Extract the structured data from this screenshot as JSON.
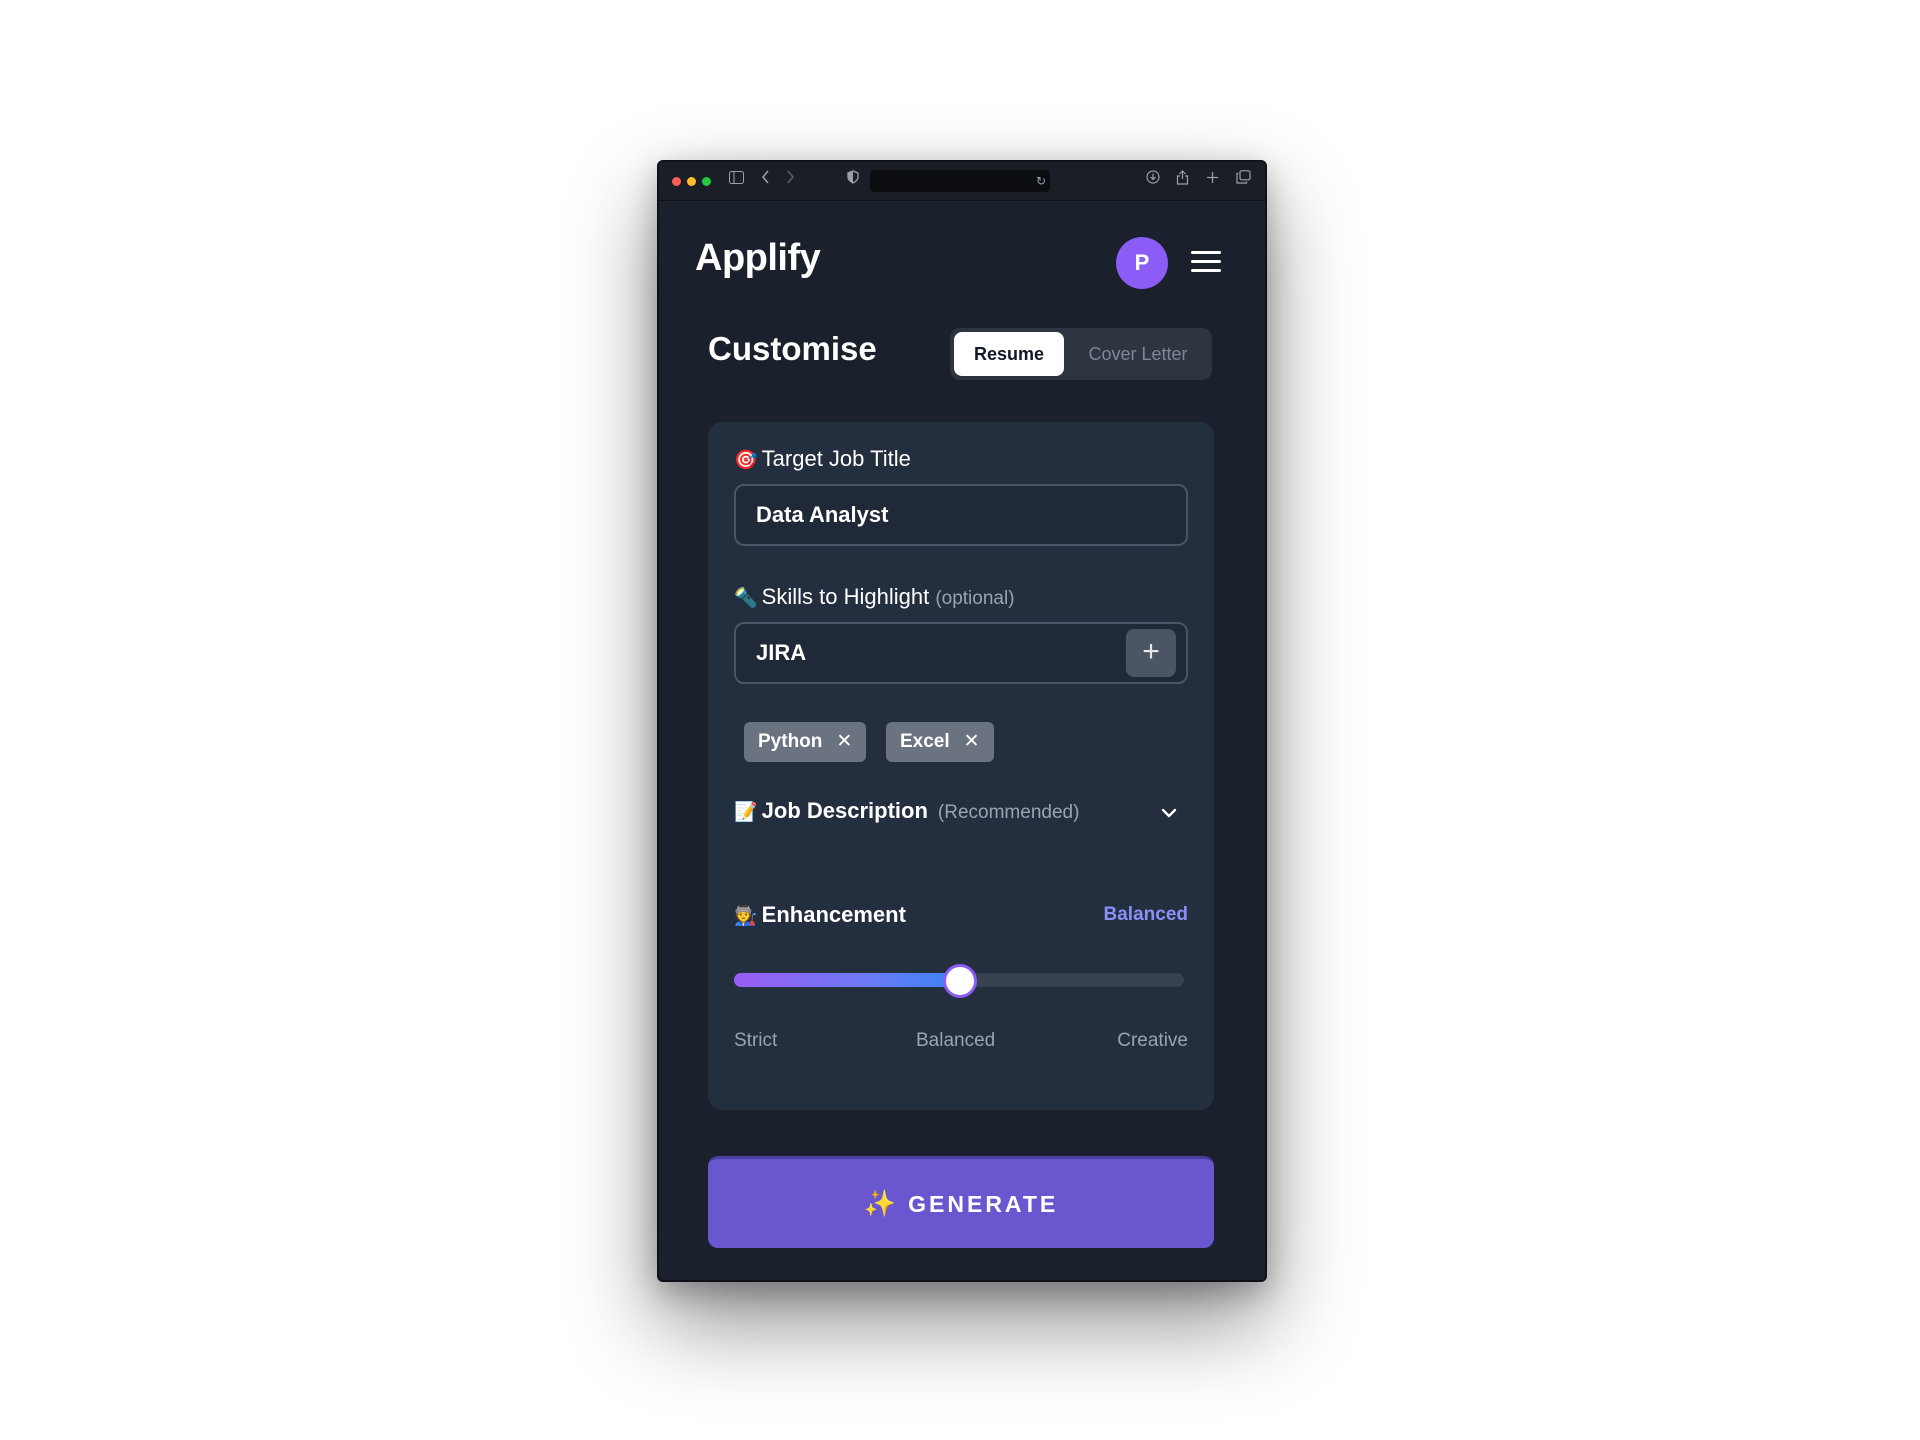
{
  "browser": {
    "icons": [
      "sidebar-icon",
      "back-icon",
      "forward-icon",
      "shield-icon",
      "reload-icon",
      "download-icon",
      "share-icon",
      "new-tab-icon",
      "tabs-icon"
    ]
  },
  "header": {
    "logo": "Applify",
    "avatar_initial": "P"
  },
  "customise": {
    "title": "Customise",
    "tabs": [
      {
        "label": "Resume",
        "active": true
      },
      {
        "label": "Cover Letter",
        "active": false
      }
    ]
  },
  "form": {
    "job_title": {
      "emoji": "🎯",
      "label": "Target Job Title",
      "value": "Data Analyst"
    },
    "skills": {
      "emoji": "🔦",
      "label": "Skills to Highlight",
      "optional": "(optional)",
      "input_value": "JIRA",
      "add_symbol": "+",
      "chips": [
        {
          "label": "Python",
          "remove": "✕"
        },
        {
          "label": "Excel",
          "remove": "✕"
        }
      ]
    },
    "job_description": {
      "emoji": "📝",
      "label": "Job Description",
      "note": "(Recommended)"
    },
    "enhancement": {
      "emoji": "🧑‍🏭",
      "label": "Enhancement",
      "current": "Balanced",
      "level_percent": 50,
      "ticks": [
        "Strict",
        "Balanced",
        "Creative"
      ]
    }
  },
  "generate": {
    "emoji": "✨",
    "label": "GENERATE"
  },
  "colors": {
    "accent": "#8b5cf6",
    "generate_bg": "#6a57cf",
    "panel_bg": "#232e3e",
    "page_bg": "#1b212c"
  }
}
